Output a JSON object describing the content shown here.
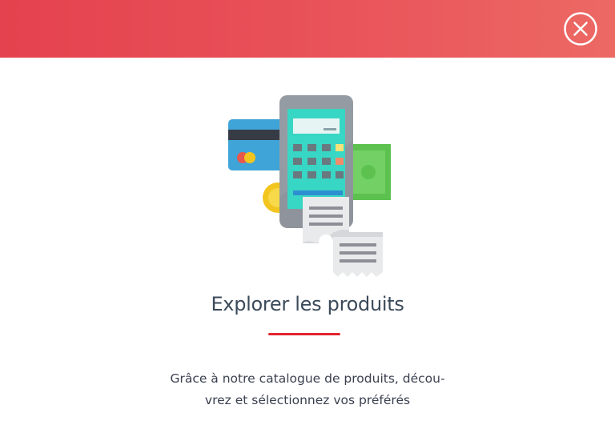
{
  "header": {
    "close_icon": "close-circle-icon",
    "color_start": "#e4424e",
    "color_end": "#ec6964"
  },
  "illustration": {
    "icon": "payment-terminal-icon"
  },
  "content": {
    "title": "Explorer les produits",
    "description_line1": "Grâce à notre catalogue de produits, décou-",
    "description_line2": "vrez et sélectionnez vos préférés",
    "accent_color": "#e2242f"
  }
}
